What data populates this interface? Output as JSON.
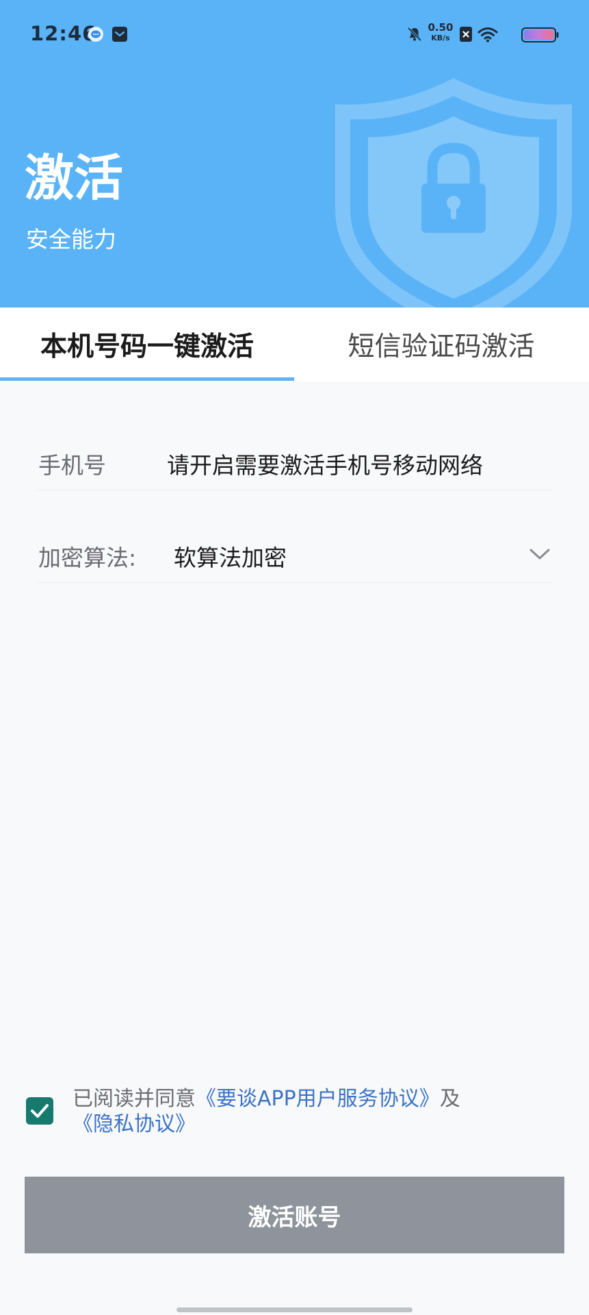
{
  "status_bar": {
    "time": "12:46",
    "net_speed_value": "0.50",
    "net_speed_unit": "KB/s",
    "icons": [
      "chat-app-icon",
      "mail-app-icon",
      "bell-muted-icon",
      "sim-x-icon",
      "wifi-icon",
      "battery-icon"
    ]
  },
  "header": {
    "title": "激活",
    "subtitle": "安全能力",
    "illustration": "shield-lock-icon",
    "background_color": "#5ab3f7"
  },
  "tabs": [
    {
      "label": "本机号码一键激活",
      "active": true
    },
    {
      "label": "短信验证码激活",
      "active": false
    }
  ],
  "form": {
    "phone": {
      "label": "手机号",
      "value": "请开启需要激活手机号移动网络"
    },
    "encryption": {
      "label": "加密算法:",
      "selected": "软算法加密"
    }
  },
  "agreement": {
    "checked": true,
    "prefix": "已阅读并同意",
    "user_agreement": "《要谈APP用户服务协议》",
    "conjunction": "及",
    "privacy_policy": "《隐私协议》"
  },
  "action": {
    "activate_label": "激活账号",
    "button_color": "#8f949c"
  },
  "colors": {
    "accent": "#5ab3f7",
    "checkbox": "#167a6e",
    "link": "#3b73c6"
  }
}
